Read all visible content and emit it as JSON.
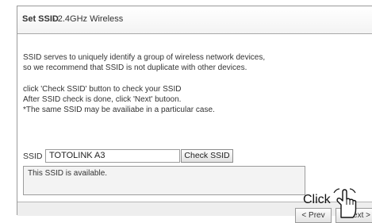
{
  "dialog": {
    "title_main": "Set SSID",
    "title_sub": "- 2.4GHz Wireless"
  },
  "description": {
    "line1": "SSID serves to uniquely identify a group of wireless network devices,",
    "line2": "so we recommend that SSID is not duplicate with other devices.",
    "line3": "click 'Check SSID' button to check your SSID",
    "line4": "After SSID check is done, click 'Next' butoon.",
    "line5": "*The same SSID may be availiabe in a particular case."
  },
  "ssid_form": {
    "label": "SSID",
    "value": "TOTOLINK A3",
    "check_button": "Check SSID",
    "result": "This SSID is available."
  },
  "navigation": {
    "prev_label": "< Prev",
    "next_label": "Next >"
  },
  "annotation": {
    "click_label": "Click",
    "pointer_icon": "hand-pointer-icon"
  }
}
